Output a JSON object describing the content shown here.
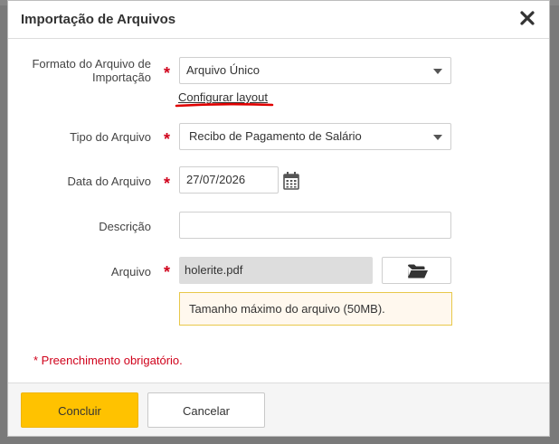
{
  "dialog": {
    "title": "Importação de Arquivos"
  },
  "form": {
    "format_label": "Formato do Arquivo de Importação",
    "format_value": "Arquivo Único",
    "configure_link": "Configurar layout",
    "type_label": "Tipo do Arquivo",
    "type_value": "Recibo de Pagamento de Salário",
    "date_label": "Data do Arquivo",
    "date_value": "27/07/2026",
    "description_label": "Descrição",
    "description_value": "",
    "file_label": "Arquivo",
    "file_value": "holerite.pdf",
    "file_info": "Tamanho máximo do arquivo (50MB).",
    "required_marker": "*",
    "required_note": "* Preenchimento obrigatório."
  },
  "footer": {
    "confirm_label": "Concluir",
    "cancel_label": "Cancelar"
  },
  "colors": {
    "primary_button": "#ffc200",
    "required": "#d0021b",
    "annotation_underline": "#e00000",
    "info_border": "#e8c84a"
  },
  "icons": {
    "close": "close-icon",
    "dropdown": "chevron-down-icon",
    "calendar": "calendar-icon",
    "folder": "folder-open-icon"
  }
}
